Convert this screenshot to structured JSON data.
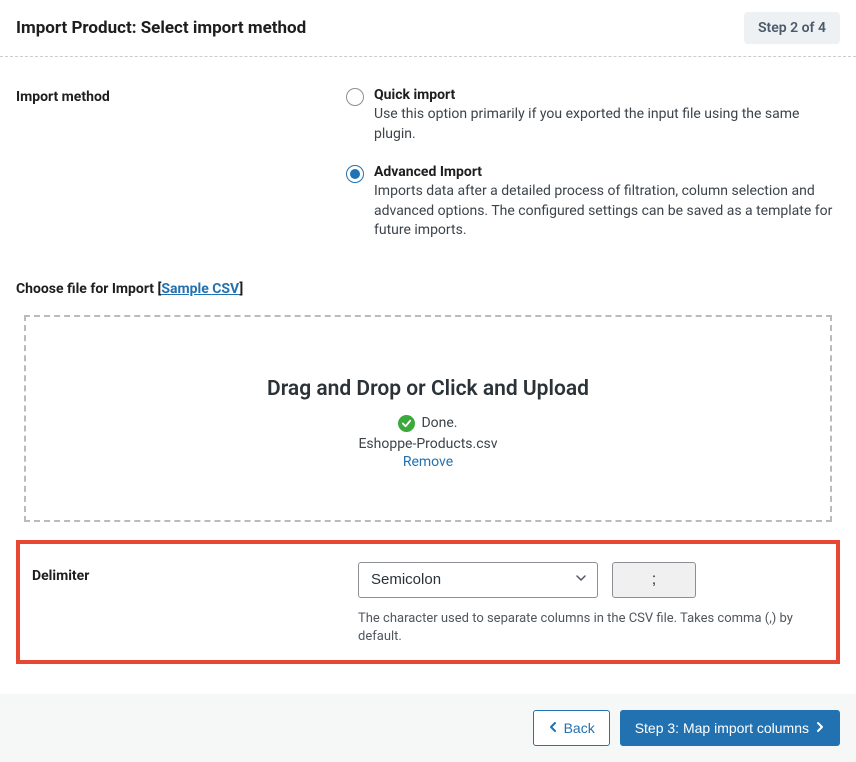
{
  "header": {
    "title": "Import Product: Select import method",
    "step_badge": "Step 2 of 4"
  },
  "import_method": {
    "label": "Import method",
    "options": [
      {
        "title": "Quick import",
        "desc": "Use this option primarily if you exported the input file using the same plugin.",
        "selected": false
      },
      {
        "title": "Advanced Import",
        "desc": "Imports data after a detailed process of filtration, column selection and advanced options. The configured settings can be saved as a template for future imports.",
        "selected": true
      }
    ]
  },
  "file_section": {
    "label_prefix": "Choose file for Import [",
    "sample_link": "Sample CSV",
    "label_suffix": "]",
    "dropzone_title": "Drag and Drop or Click and Upload",
    "done_text": "Done.",
    "filename": "Eshoppe-Products.csv",
    "remove_text": "Remove"
  },
  "delimiter": {
    "label": "Delimiter",
    "select_value": "Semicolon",
    "input_value": ";",
    "desc": "The character used to separate columns in the CSV file. Takes comma (,) by default."
  },
  "footer": {
    "back": "Back",
    "next": "Step 3: Map import columns"
  }
}
